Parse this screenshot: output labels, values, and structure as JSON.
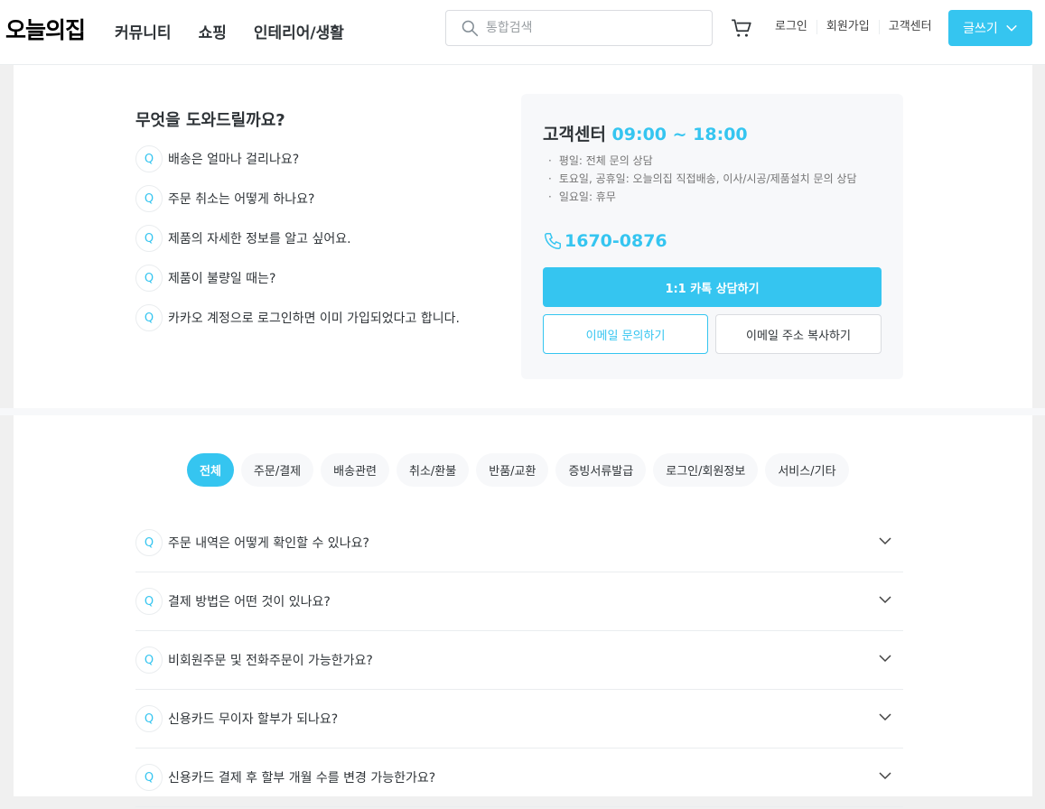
{
  "header": {
    "logo": "오늘의집",
    "nav": [
      "커뮤니티",
      "쇼핑",
      "인테리어/생활"
    ],
    "search_placeholder": "통합검색",
    "util_links": [
      "로그인",
      "회원가입",
      "고객센터"
    ],
    "write_label": "글쓰기"
  },
  "help": {
    "title": "무엇을 도와드릴까요?",
    "q_mark": "Q",
    "quick_questions": [
      "배송은 얼마나 걸리나요?",
      "주문 취소는 어떻게 하나요?",
      "제품의 자세한 정보를 알고 싶어요.",
      "제품이 불량일 때는?",
      "카카오 계정으로 로그인하면 이미 가입되었다고 합니다."
    ]
  },
  "cs": {
    "title": "고객센터",
    "hours": "09:00 ~ 18:00",
    "info": [
      "평일: 전체 문의 상담",
      "토요일, 공휴일: 오늘의집 직접배송, 이사/시공/제품설치 문의 상담",
      "일요일: 휴무"
    ],
    "phone": "1670-0876",
    "kakao_label": "1:1 카톡 상담하기",
    "email_label": "이메일 문의하기",
    "copy_label": "이메일 주소 복사하기"
  },
  "tabs": [
    "전체",
    "주문/결제",
    "배송관련",
    "취소/환불",
    "반품/교환",
    "증빙서류발급",
    "로그인/회원정보",
    "서비스/기타"
  ],
  "active_tab": "전체",
  "faq": [
    "주문 내역은 어떻게 확인할 수 있나요?",
    "결제 방법은 어떤 것이 있나요?",
    "비회원주문 및 전화주문이 가능한가요?",
    "신용카드 무이자 할부가 되나요?",
    "신용카드 결제 후 할부 개월 수를 변경 가능한가요?"
  ],
  "colors": {
    "accent": "#35c5f0",
    "text": "#2f3438",
    "muted": "#757575"
  },
  "icons": [
    "search-icon",
    "cart-icon",
    "chevron-down-icon",
    "phone-icon"
  ]
}
